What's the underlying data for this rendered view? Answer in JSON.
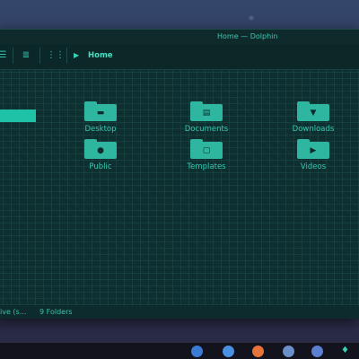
{
  "window": {
    "title": "Home — Dolphin"
  },
  "toolbar": {
    "icons": [
      "icons-view-icon",
      "details-view-icon",
      "compact-view-icon"
    ],
    "breadcrumb": "Home"
  },
  "folders": [
    {
      "label": "Desktop",
      "icon": "desktop-folder-icon",
      "glyph": "▬"
    },
    {
      "label": "Documents",
      "icon": "documents-folder-icon",
      "glyph": "▤"
    },
    {
      "label": "Downloads",
      "icon": "downloads-folder-icon",
      "glyph": "▼"
    },
    {
      "label": "Public",
      "icon": "public-folder-icon",
      "glyph": "●"
    },
    {
      "label": "Templates",
      "icon": "templates-folder-icon",
      "glyph": "▢"
    },
    {
      "label": "Videos",
      "icon": "videos-folder-icon",
      "glyph": "▶"
    }
  ],
  "status": {
    "left": "ive (s...",
    "count": "9 Folders"
  },
  "colors": {
    "accent": "#2fb6a0",
    "text": "#35c8b0",
    "background": "#0e2f30"
  },
  "taskbar": {
    "icons": [
      {
        "name": "app-icon-1",
        "color": "#3a7bd5"
      },
      {
        "name": "app-icon-2",
        "color": "#4a90e2"
      },
      {
        "name": "firefox-icon",
        "color": "#e8733a"
      },
      {
        "name": "app-icon-4",
        "color": "#6b8fc8"
      },
      {
        "name": "app-icon-5",
        "color": "#5c7fd0"
      }
    ]
  }
}
